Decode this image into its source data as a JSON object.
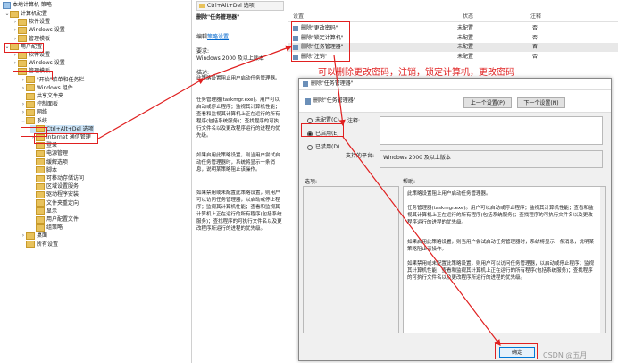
{
  "tree": {
    "root": "本地计算机 策略",
    "items": [
      {
        "label": "计算机配置",
        "expander": "⌄",
        "level": 1
      },
      {
        "label": "软件设置",
        "expander": "›",
        "level": 2
      },
      {
        "label": "Windows 设置",
        "expander": "›",
        "level": 2
      },
      {
        "label": "管理模板",
        "expander": "›",
        "level": 2
      },
      {
        "label": "用户配置",
        "expander": "⌄",
        "level": 1
      },
      {
        "label": "软件设置",
        "expander": "›",
        "level": 2
      },
      {
        "label": "Windows 设置",
        "expander": "›",
        "level": 2
      },
      {
        "label": "管理模板",
        "expander": "⌄",
        "level": 2
      },
      {
        "label": "\"开始\"菜单和任务栏",
        "expander": "›",
        "level": 3
      },
      {
        "label": "Windows 组件",
        "expander": "›",
        "level": 3
      },
      {
        "label": "共享文件夹",
        "expander": "",
        "level": 3
      },
      {
        "label": "控制面板",
        "expander": "›",
        "level": 3
      },
      {
        "label": "网络",
        "expander": "›",
        "level": 3
      },
      {
        "label": "系统",
        "expander": "⌄",
        "level": 3
      },
      {
        "label": "Ctrl+Alt+Del 选项",
        "expander": "",
        "level": 4
      },
      {
        "label": "Internet 通信管理",
        "expander": "›",
        "level": 4
      },
      {
        "label": "登录",
        "expander": "",
        "level": 4
      },
      {
        "label": "电源管理",
        "expander": "",
        "level": 4
      },
      {
        "label": "缓解选项",
        "expander": "",
        "level": 4
      },
      {
        "label": "脚本",
        "expander": "",
        "level": 4
      },
      {
        "label": "可移动存储访问",
        "expander": "",
        "level": 4
      },
      {
        "label": "区域设置服务",
        "expander": "",
        "level": 4
      },
      {
        "label": "驱动程序安装",
        "expander": "",
        "level": 4
      },
      {
        "label": "文件夹重定向",
        "expander": "",
        "level": 4
      },
      {
        "label": "显示",
        "expander": "",
        "level": 4
      },
      {
        "label": "用户配置文件",
        "expander": "",
        "level": 4
      },
      {
        "label": "组策略",
        "expander": "",
        "level": 4
      },
      {
        "label": "桌面",
        "expander": "›",
        "level": 3
      },
      {
        "label": "所有设置",
        "expander": "",
        "level": 3
      }
    ]
  },
  "middle": {
    "header": "Ctrl+Alt+Del 选项",
    "title": "删除\"任务管理器\"",
    "edit_prefix": "编辑",
    "edit_link": "策略设置",
    "req_label": "要求:",
    "req_value": "Windows 2000 及以上版本",
    "desc_label": "描述:",
    "desc_p1": "此策略设置阻止用户启动任务管理器。",
    "desc_p2": "任务管理器(taskmgr.exe)。用户可以启动或停止程序；监视其计算机性能；查看和监视其计算机上正在运行的所有程序(包括系统服务)；查找程序的可执行文件名以及更改程序运行的进程的优先级。",
    "desc_p3": "如果启用此策略设置，则当用户尝试启动任务管理器时，系统将显示一条消息，说明某策略阻止该操作。",
    "desc_p4": "如果禁用或未配置此策略设置，则用户可以访问任务管理器，以启动或停止程序；监视其计算机性能；查看和监视其计算机上正在运行的所有程序(包括系统服务)；查找程序的可执行文件名以及更改程序所运行的进程的优先级。"
  },
  "list": {
    "col_setting": "设置",
    "col_state": "状态",
    "col_comment": "注释",
    "rows": [
      {
        "name": "删除\"更改密码\"",
        "state": "未配置",
        "comment": "否"
      },
      {
        "name": "删除\"锁定计算机\"",
        "state": "未配置",
        "comment": "否"
      },
      {
        "name": "删除\"任务管理器\"",
        "state": "未配置",
        "comment": "否"
      },
      {
        "name": "删除\"注销\"",
        "state": "未配置",
        "comment": "否"
      }
    ]
  },
  "annotation": "可以删除更改密码，注销，锁定计算机，更改密码",
  "dialog": {
    "title": "删除\"任务管理器\"",
    "subtitle": "删除\"任务管理器\"",
    "prev_btn": "上一个设置(P)",
    "next_btn": "下一个设置(N)",
    "opt_unconfigured": "未配置(C)",
    "opt_enabled": "已启用(E)",
    "opt_disabled": "已禁用(D)",
    "comment_label": "注释:",
    "platform_label": "支持的平台:",
    "platform_value": "Windows 2000 及以上版本",
    "options_label": "选项:",
    "help_label": "帮助:",
    "help_p1": "此策略设置阻止用户启动任务管理器。",
    "help_p2": "任务管理器(taskmgr.exe)。用户可以启动或停止程序；监视其计算机性能；查看和监视其计算机上正在运行的所有程序(包括系统服务)；查找程序的可执行文件名以及更改程序运行的进程的优先级。",
    "help_p3": "如果启用此策略设置，则当用户尝试启动任务管理器时，系统将显示一条消息，说明某策略阻止该操作。",
    "help_p4": "如果禁用或未配置此策略设置，则用户可以访问任务管理器，以启动或停止程序；监视其计算机性能；查看和监视其计算机上正在运行的所有程序(包括系统服务)；查找程序的可执行文件名以及更改程序所运行的进程的优先级。",
    "ok_btn": "确定"
  },
  "watermark": "CSDN @五月"
}
